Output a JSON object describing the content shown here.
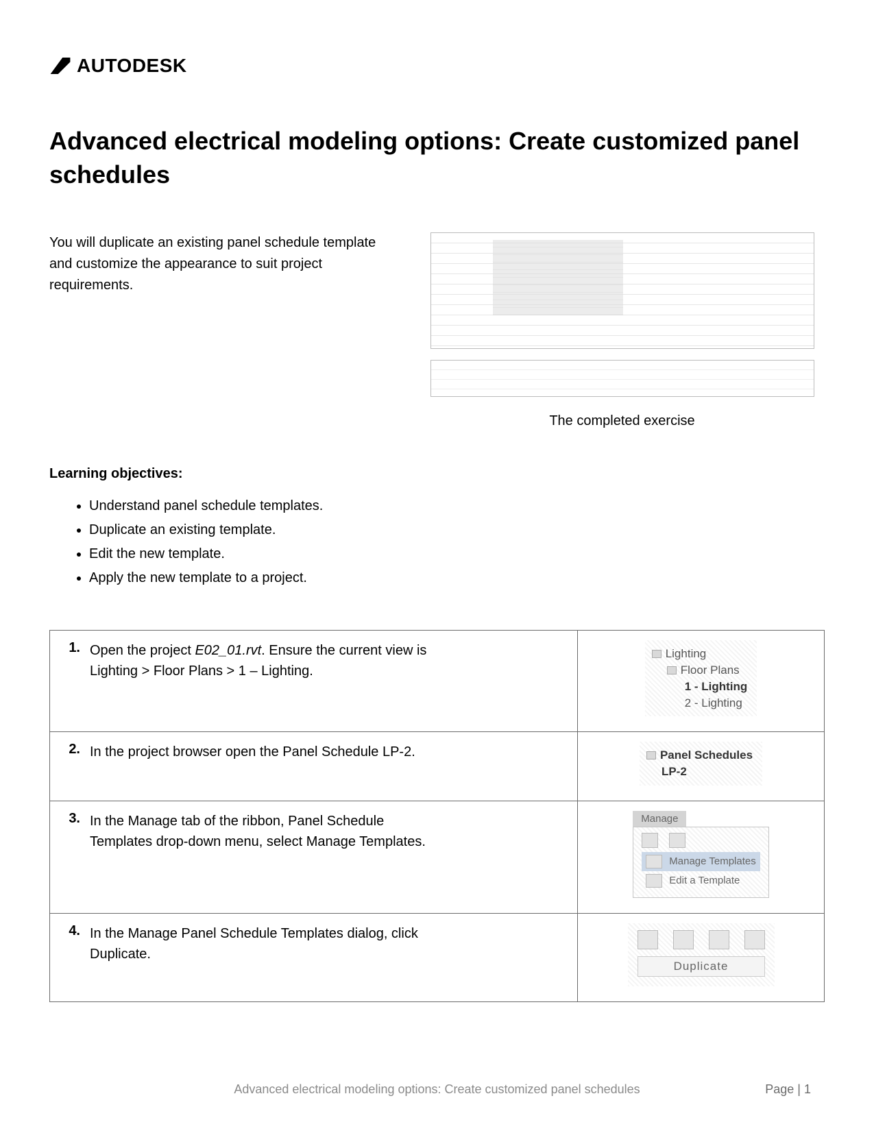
{
  "brand": {
    "name": "AUTODESK"
  },
  "title": "Advanced electrical modeling options: Create customized panel schedules",
  "intro": "You will duplicate an existing panel schedule template and customize the appearance to suit project requirements.",
  "figure_caption": "The completed exercise",
  "objectives_heading": "Learning objectives:",
  "objectives": [
    "Understand panel schedule templates.",
    "Duplicate an existing template.",
    "Edit the new template.",
    "Apply the new template to a project."
  ],
  "steps": [
    {
      "num": "1.",
      "text_pre": "Open the project ",
      "text_italic": "E02_01.rvt",
      "text_post": ". Ensure the current view is Lighting > Floor Plans > 1 – Lighting.",
      "tree": {
        "l0": "Lighting",
        "l1": "Floor Plans",
        "l2a": "1 - Lighting",
        "l2b": "2 - Lighting"
      }
    },
    {
      "num": "2.",
      "text": "In the project browser open the Panel Schedule LP-2.",
      "tree2": {
        "l0": "Panel Schedules",
        "l1": "LP-2"
      }
    },
    {
      "num": "3.",
      "text": "In the Manage tab of the ribbon, Panel Schedule Templates drop-down menu, select Manage Templates.",
      "ribbon": {
        "tab": "Manage",
        "item1": "Manage Templates",
        "item2": "Edit a Template"
      }
    },
    {
      "num": "4.",
      "text": "In the Manage Panel Schedule Templates dialog, click Duplicate.",
      "dup_label": "Duplicate"
    }
  ],
  "footer": {
    "title": "Advanced electrical modeling options: Create customized panel schedules",
    "page": "Page | 1"
  }
}
